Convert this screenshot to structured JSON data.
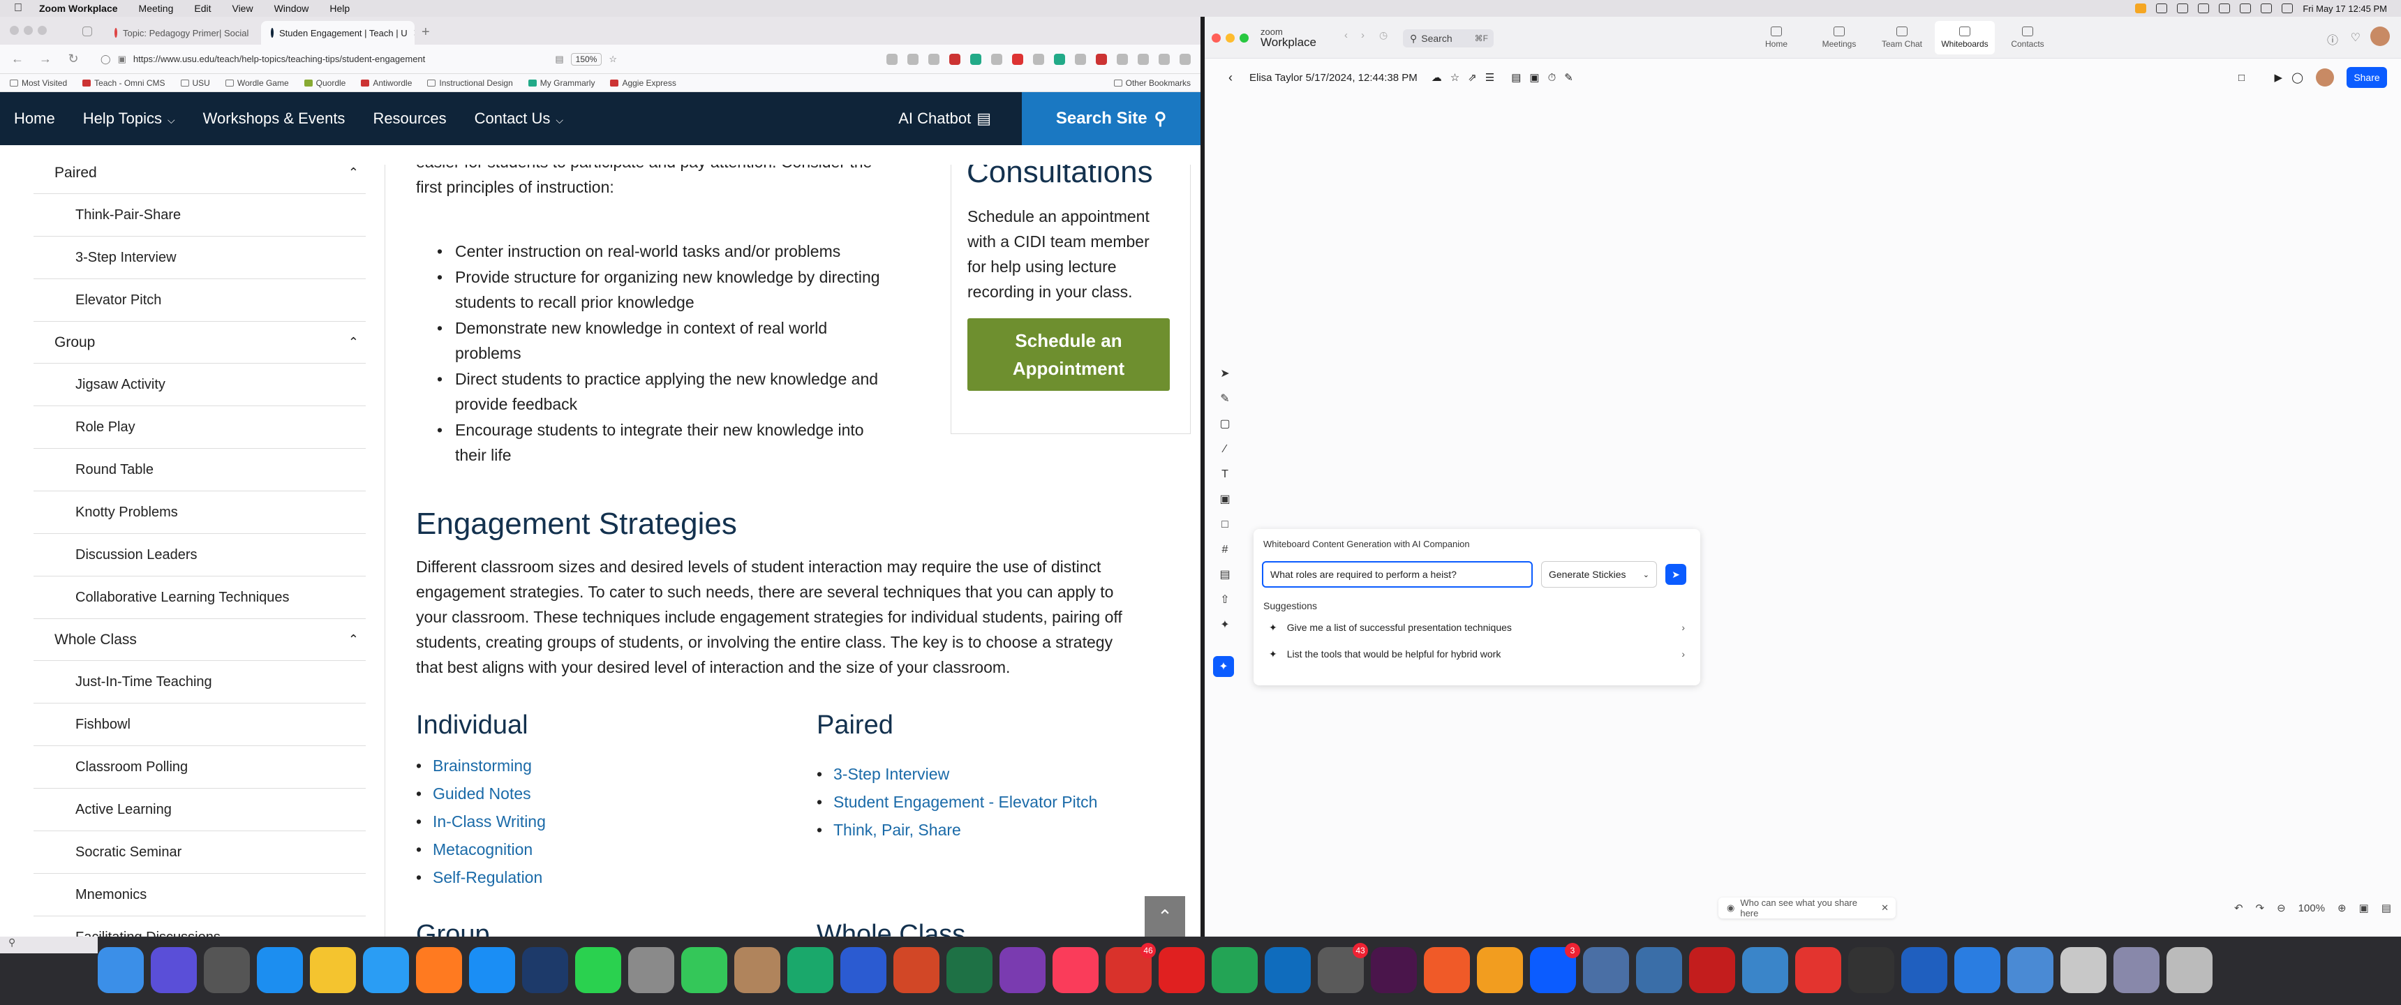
{
  "menubar": {
    "app": "Zoom Workplace",
    "items": [
      "Meeting",
      "Edit",
      "View",
      "Window",
      "Help"
    ],
    "clock": "Fri May 17  12:45 PM"
  },
  "browser": {
    "tabs": [
      {
        "label": "Topic: Pedagogy Primer| Social",
        "active": false
      },
      {
        "label": "Studen Engagement | Teach | U",
        "active": true
      }
    ],
    "url": "https://www.usu.edu/teach/help-topics/teaching-tips/student-engagement",
    "zoom": "150%",
    "bookmarks": [
      "Most Visited",
      "Teach - Omni CMS",
      "USU",
      "Wordle Game",
      "Quordle",
      "Antiwordle",
      "Instructional Design",
      "My Grammarly",
      "Aggie Express"
    ],
    "other_bookmarks": "Other Bookmarks"
  },
  "site": {
    "nav": [
      "Home",
      "Help Topics",
      "Workshops & Events",
      "Resources",
      "Contact Us"
    ],
    "chatbot": "AI Chatbot",
    "search": "Search Site",
    "sidebar": [
      {
        "type": "head",
        "label": "Paired"
      },
      {
        "type": "item",
        "label": "Think-Pair-Share"
      },
      {
        "type": "item",
        "label": "3-Step Interview"
      },
      {
        "type": "item",
        "label": "Elevator Pitch"
      },
      {
        "type": "head",
        "label": "Group"
      },
      {
        "type": "item",
        "label": "Jigsaw Activity"
      },
      {
        "type": "item",
        "label": "Role Play"
      },
      {
        "type": "item",
        "label": "Round Table"
      },
      {
        "type": "item",
        "label": "Knotty Problems"
      },
      {
        "type": "item",
        "label": "Discussion Leaders"
      },
      {
        "type": "item",
        "label": "Collaborative Learning Techniques"
      },
      {
        "type": "head",
        "label": "Whole Class"
      },
      {
        "type": "item",
        "label": "Just-In-Time Teaching"
      },
      {
        "type": "item",
        "label": "Fishbowl"
      },
      {
        "type": "item",
        "label": "Classroom Polling"
      },
      {
        "type": "item",
        "label": "Active Learning"
      },
      {
        "type": "item",
        "label": "Socratic Seminar"
      },
      {
        "type": "item",
        "label": "Mnemonics"
      },
      {
        "type": "item",
        "label": "Facilitating Discussions"
      }
    ],
    "intro_lines": [
      "easier for students to participate and pay attention. Consider the",
      "first principles of instruction:"
    ],
    "principles": [
      [
        "Center instruction on real-world tasks and/or problems"
      ],
      [
        "Provide structure for organizing new knowledge by directing",
        "students to recall prior knowledge"
      ],
      [
        "Demonstrate new knowledge in context of real world",
        "problems"
      ],
      [
        "Direct students to practice applying the new knowledge and",
        "provide feedback"
      ],
      [
        "Encourage students to integrate their new knowledge into",
        "their life"
      ]
    ],
    "consult_title": "Consultations",
    "consult_lines": [
      "Schedule an appointment",
      "with a CIDI team member",
      "for help using lecture",
      "recording in your class."
    ],
    "consult_button": [
      "Schedule an",
      "Appointment"
    ],
    "engagement_heading": "Engagement Strategies",
    "engagement_lines": [
      "Different classroom sizes and desired levels of student interaction may require the use of distinct",
      "engagement strategies. To cater to such needs, there are several techniques that you can apply to",
      "your classroom. These techniques include engagement strategies for individual students, pairing off",
      "students, creating groups of students, or involving the entire class. The key is to choose a strategy",
      "that best aligns with your desired level of interaction and the size of your classroom."
    ],
    "individual_heading": "Individual",
    "individual_links": [
      "Brainstorming",
      "Guided Notes",
      "In-Class Writing",
      "Metacognition",
      "Self-Regulation"
    ],
    "paired_heading": "Paired",
    "paired_links": [
      "3-Step Interview",
      "Student Engagement - Elevator Pitch",
      "Think, Pair, Share"
    ],
    "group_heading": "Group",
    "wholeclass_heading": "Whole Class"
  },
  "zoom": {
    "logo_small": "zoom",
    "logo_big": "Workplace",
    "search": "Search",
    "search_kbd": "⌘F",
    "tabs": [
      "Home",
      "Meetings",
      "Team Chat",
      "Whiteboards",
      "Contacts"
    ],
    "active_tab": "Whiteboards",
    "board_title": "Elisa Taylor 5/17/2024, 12:44:38 PM",
    "share": "Share",
    "ai_title": "Whiteboard Content Generation with AI Companion",
    "ai_input": "What roles are required to perform a heist?",
    "ai_select": "Generate Stickies",
    "suggestions_label": "Suggestions",
    "suggestions": [
      "Give me a list of successful presentation techniques",
      "List the tools that would be helpful for hybrid work"
    ],
    "who_can_see": "Who can see what you share here",
    "zoom_level": "100%"
  },
  "dock_badges": {
    "mail": "43",
    "tasks": "46",
    "app3": "3"
  },
  "colors": {
    "nav": "#0f2439",
    "search": "#1a78c2",
    "button": "#6e8f2f",
    "zoom_blue": "#0b5cff",
    "link": "#1a6aa8"
  }
}
